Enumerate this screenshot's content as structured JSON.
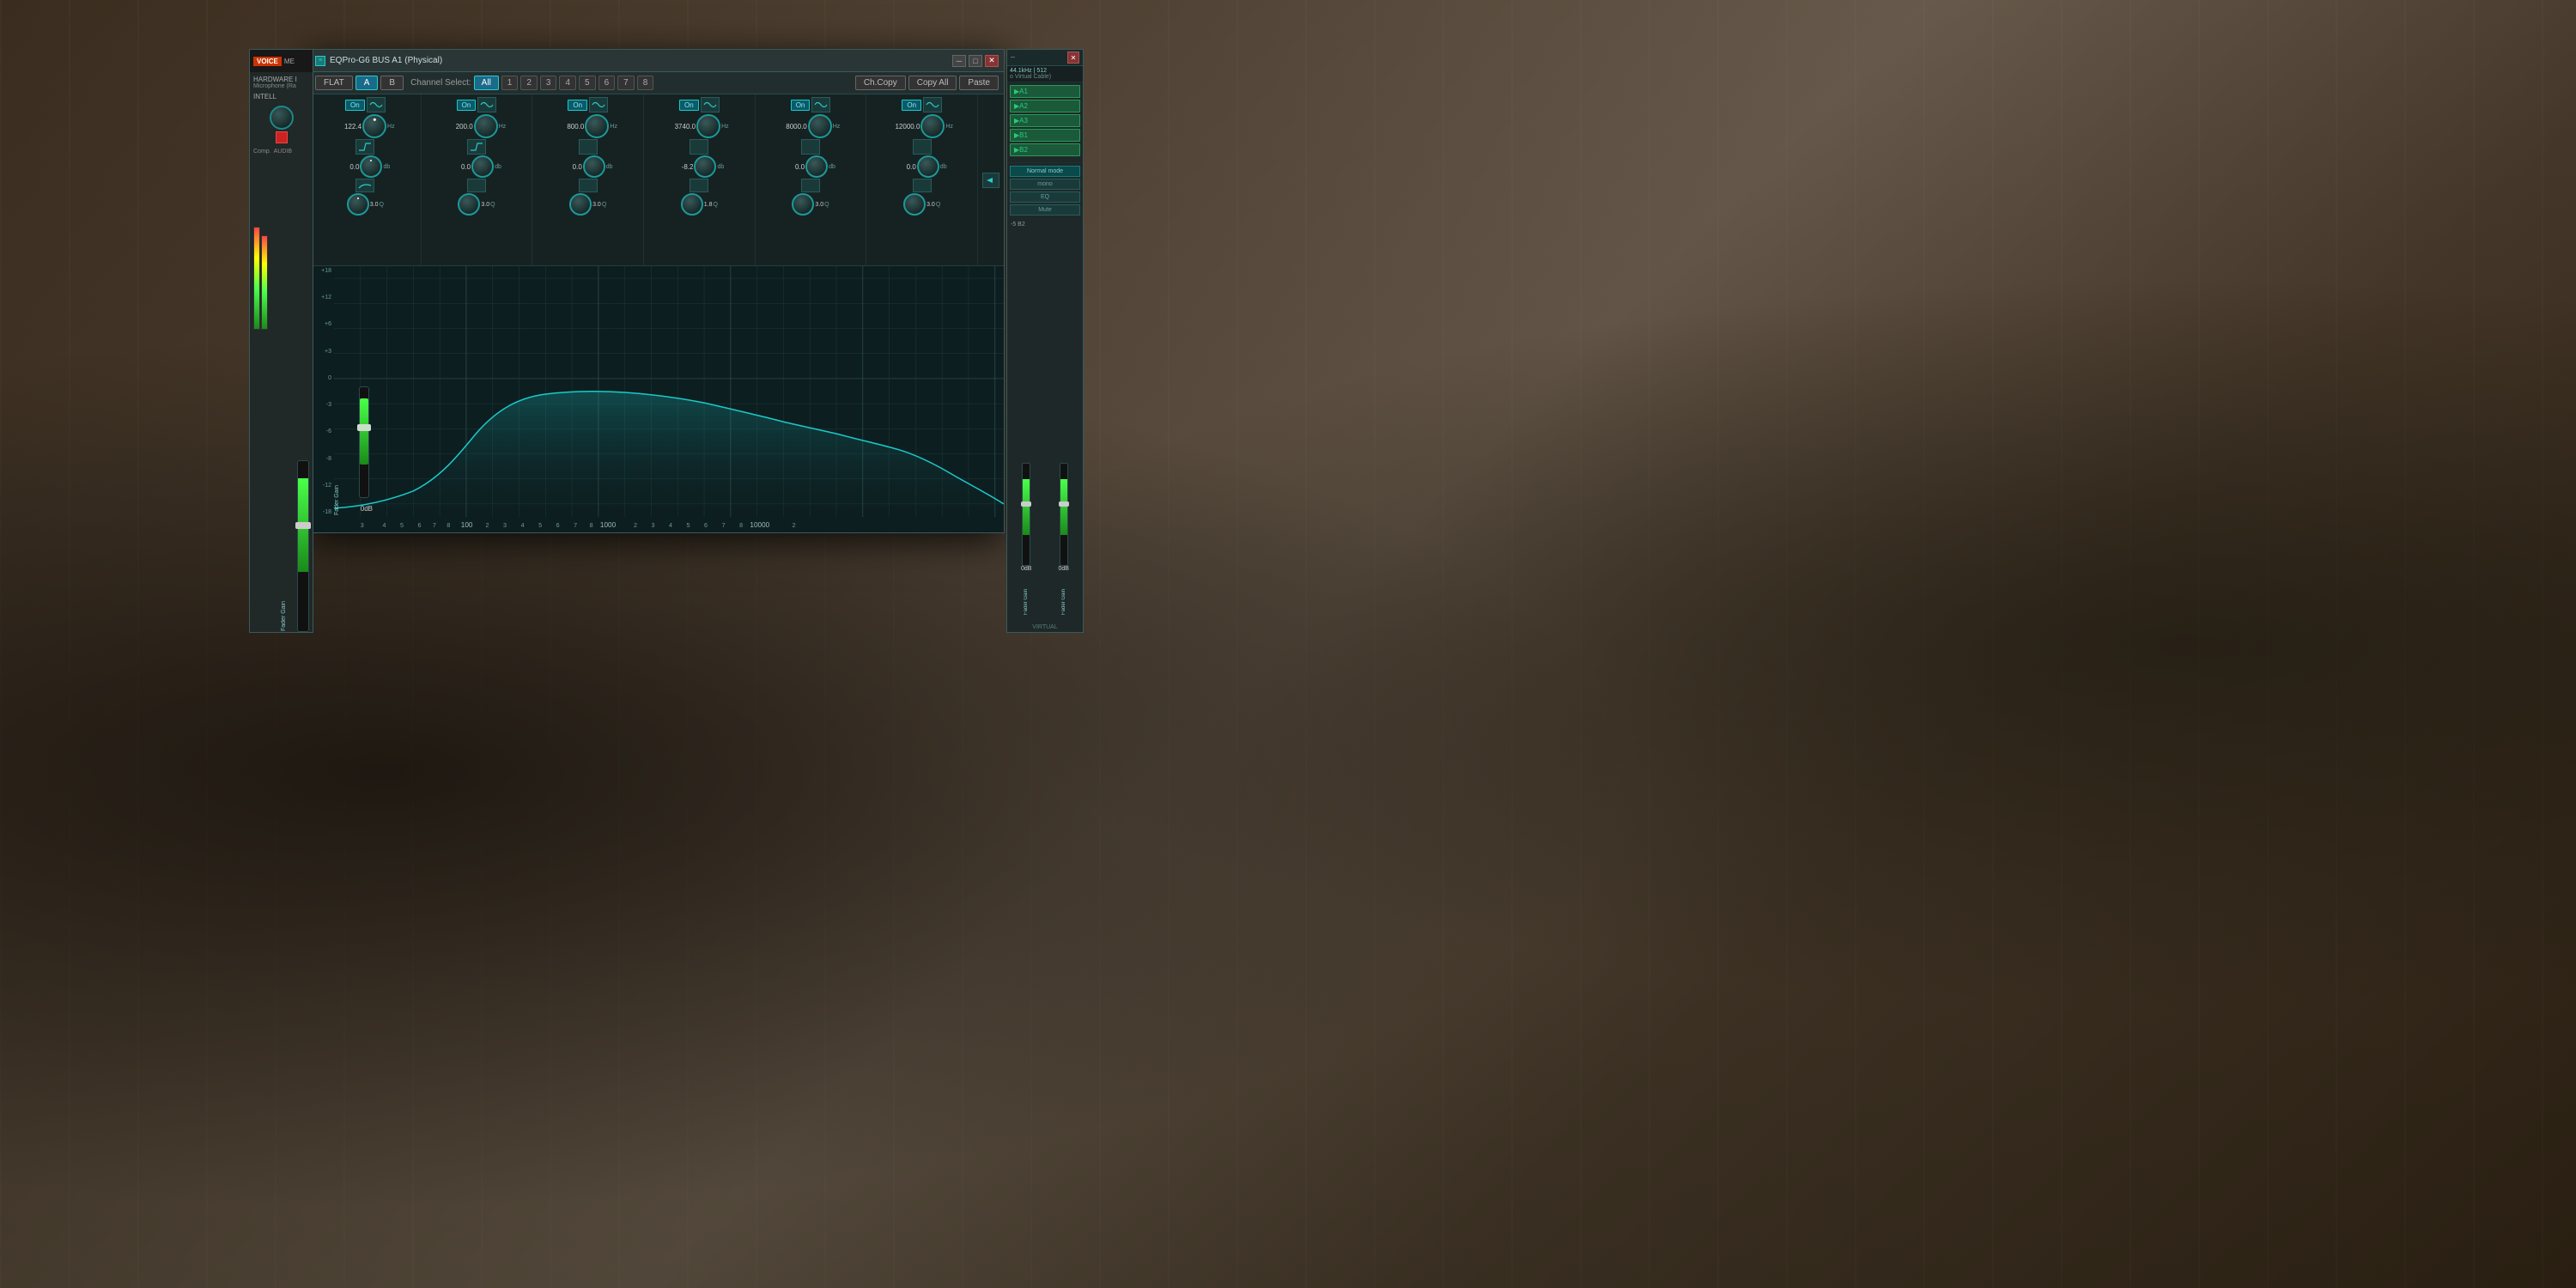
{
  "background": {
    "desc": "motorcycle workshop background"
  },
  "title_bar": {
    "title": "EQPro-G6 BUS A1 (Physical)",
    "icon": "eq",
    "minimize": "─",
    "restore": "□",
    "close": "✕"
  },
  "toolbar": {
    "flat_label": "FLAT",
    "a_label": "A",
    "b_label": "B",
    "channel_select_label": "Channel Select:",
    "channels": [
      "All",
      "1",
      "2",
      "3",
      "4",
      "5",
      "6",
      "7",
      "8"
    ],
    "active_channel": "All",
    "ch_copy_label": "Ch.Copy",
    "copy_all_label": "Copy All",
    "paste_label": "Paste"
  },
  "bands": [
    {
      "id": 1,
      "on": true,
      "freq": "122.4",
      "freq_unit": "Hz",
      "gain": "0.0",
      "gain_unit": "db",
      "q": "3.0",
      "q_label": "Q",
      "knob_freq_angle": 180,
      "knob_gain_angle": 270,
      "knob_q_angle": 270
    },
    {
      "id": 2,
      "on": true,
      "freq": "200.0",
      "freq_unit": "Hz",
      "gain": "0.0",
      "gain_unit": "db",
      "q": "3.0",
      "q_label": "Q",
      "knob_freq_angle": 190,
      "knob_gain_angle": 270,
      "knob_q_angle": 270
    },
    {
      "id": 3,
      "on": true,
      "freq": "800.0",
      "freq_unit": "Hz",
      "gain": "0.0",
      "gain_unit": "db",
      "q": "3.0",
      "q_label": "Q",
      "knob_freq_angle": 210,
      "knob_gain_angle": 270,
      "knob_q_angle": 270
    },
    {
      "id": 4,
      "on": true,
      "freq": "3740.0",
      "freq_unit": "Hz",
      "gain": "-8.2",
      "gain_unit": "db",
      "q": "1.8",
      "q_label": "Q",
      "knob_freq_angle": 230,
      "knob_gain_angle": 200,
      "knob_q_angle": 250
    },
    {
      "id": 5,
      "on": true,
      "freq": "8000.0",
      "freq_unit": "Hz",
      "gain": "0.0",
      "gain_unit": "db",
      "q": "3.0",
      "q_label": "Q",
      "knob_freq_angle": 250,
      "knob_gain_angle": 270,
      "knob_q_angle": 270
    },
    {
      "id": 6,
      "on": true,
      "freq": "12000.0",
      "freq_unit": "Hz",
      "gain": "0.0",
      "gain_unit": "db",
      "q": "3.0",
      "q_label": "Q",
      "knob_freq_angle": 260,
      "knob_gain_angle": 270,
      "knob_q_angle": 270
    }
  ],
  "eq_display": {
    "db_labels": [
      "+18",
      "+12",
      "+6",
      "+3",
      "0",
      "-3",
      "-6",
      "-8",
      "-12",
      "-18"
    ],
    "freq_labels": [
      "3",
      "4",
      "5",
      "6",
      "7",
      "8",
      "100",
      "2",
      "3",
      "4",
      "5",
      "6",
      "7",
      "8",
      "1000",
      "2",
      "3",
      "4",
      "5",
      "6",
      "7",
      "8",
      "10000",
      "2"
    ],
    "grid_lines_h": 10,
    "grid_lines_v": 24
  },
  "fader": {
    "label": "Fader Gain",
    "value": "0dB"
  },
  "left_panel": {
    "voice_label": "VOICE",
    "me_label": "ME",
    "hardware_label": "HARDWARE I",
    "mic_label": "Microphone (Ra",
    "intell_label": "INTELL",
    "comp_label": "Comp.",
    "audib_label": "AUDIB"
  },
  "right_panel": {
    "sample_rate": "44.1kHz | 512",
    "virtual_cable": "o Virtual Cable)",
    "route_btns": [
      "A1",
      "A2",
      "A3",
      "B1",
      "B2"
    ],
    "mode_btns": [
      {
        "label": "Normal mode",
        "active": true
      },
      {
        "label": "mono",
        "active": false
      },
      {
        "label": "EQ",
        "active": false
      },
      {
        "label": "Mute",
        "active": false
      }
    ],
    "fader_label": "Fader Gain",
    "fader_value": "0dB",
    "fader2_value": "0dB",
    "b2_label": "-5 B2"
  }
}
